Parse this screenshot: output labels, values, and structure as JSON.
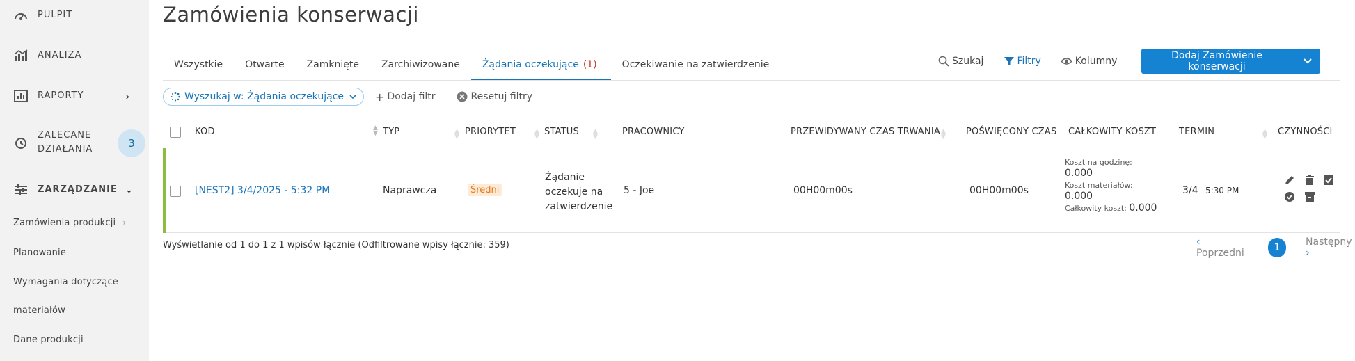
{
  "sidebar": {
    "items": [
      {
        "label": "PULPIT",
        "icon": "dashboard-icon"
      },
      {
        "label": "ANALIZA",
        "icon": "analytics-icon"
      },
      {
        "label": "RAPORTY",
        "icon": "reports-icon"
      },
      {
        "label": "ZALECANE",
        "label2": "DZIAŁANIA",
        "icon": "history-icon",
        "badge": "3"
      },
      {
        "label": "ZARZĄDZANIE",
        "icon": "management-icon"
      }
    ],
    "sub": [
      "Zamówienia produkcji",
      "Planowanie",
      "Wymagania dotyczące",
      "materiałów",
      "Dane produkcji"
    ]
  },
  "page": {
    "title": "Zamówienia konserwacji"
  },
  "tabs": [
    {
      "label": "Wszystkie"
    },
    {
      "label": "Otwarte"
    },
    {
      "label": "Zamknięte"
    },
    {
      "label": "Zarchiwizowane"
    },
    {
      "label": "Żądania oczekujące",
      "count": "(1)"
    },
    {
      "label": "Oczekiwanie na zatwierdzenie"
    }
  ],
  "toolbar": {
    "search": "Szukaj",
    "filters": "Filtry",
    "columns": "Kolumny",
    "add": "Dodaj Zamówienie konserwacji"
  },
  "filters": {
    "chip": "Wyszukaj w: Żądania oczekujące",
    "add": "Dodaj filtr",
    "reset": "Resetuj filtry"
  },
  "table": {
    "columns": [
      "KOD",
      "TYP",
      "PRIORYTET",
      "STATUS",
      "PRACOWNICY",
      "PRZEWIDYWANY CZAS TRWANIA",
      "POŚWIĘCONY CZAS",
      "CAŁKOWITY KOSZT",
      "TERMIN",
      "CZYNNOŚCI"
    ],
    "row": {
      "code": "[NEST2] 3/4/2025 - 5:32 PM",
      "type": "Naprawcza",
      "priority": "Średni",
      "status_lines": [
        "Żądanie",
        "oczekuje na",
        "zatwierdzenie"
      ],
      "workers": "5 - Joe",
      "expected": "00H00m00s",
      "spent": "00H00m00s",
      "cost_hour_label": "Koszt na godzinę:",
      "cost_hour": "0.000",
      "cost_mat_label": "Koszt materiałów:",
      "cost_mat": "0.000",
      "cost_total_label": "Całkowity koszt:",
      "cost_total": "0.000",
      "due_date": "3/4",
      "due_time": "5:30 PM"
    }
  },
  "footer": {
    "info": "Wyświetlanie od 1 do 1 z 1 wpisów łącznie (Odfiltrowane wpisy łącznie: 359)"
  },
  "pager": {
    "prev": "Poprzedni",
    "page": "1",
    "next": "Następny"
  },
  "colors": {
    "accent": "#1583d1",
    "row_marker": "#8cbd3f",
    "medium": "#e07a1f"
  }
}
